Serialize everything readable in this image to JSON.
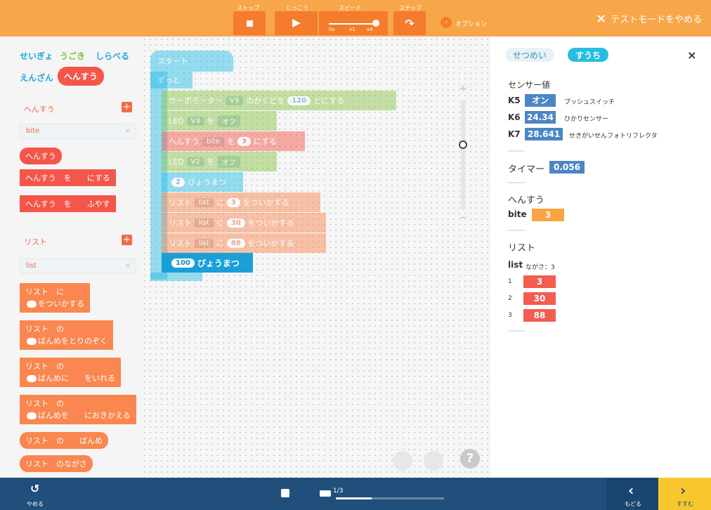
{
  "topbar": {
    "stop_caption": "ストップ",
    "run_caption": "じっこう",
    "speed_caption": "スピード",
    "step_caption": "ステップ",
    "speed_min": "0x",
    "speed_mid": "x1",
    "speed_max": "x4",
    "option_label": "オプション",
    "option_icon": "‹",
    "quit_label": "テストモードをやめる",
    "quit_icon": "×"
  },
  "palette": {
    "categories": [
      "せいぎょ",
      "うごき",
      "しらべる",
      "えんざん",
      "へんすう"
    ],
    "category_colors": [
      "#23a9dd",
      "#7cc142",
      "#23a9dd",
      "#23a9dd",
      "#f4564a"
    ],
    "var_section": "へんすう",
    "var_field": "bite",
    "var_blocks": [
      "へんすう",
      "へんすう　を　　にする",
      "へんすう　を　　ふやす"
    ],
    "list_section": "リスト",
    "list_field": "list",
    "list_blocks": [
      [
        "リスト　に",
        "をついかする"
      ],
      [
        "リスト　の",
        "ばんめをとりのぞく"
      ],
      [
        "リスト　の",
        "ばんめに　　をいれる"
      ],
      [
        "リスト　の",
        "ばんめを　　におきかえる"
      ],
      [
        "リスト　の　　ばんめ"
      ],
      [
        "リスト　のながさ"
      ]
    ],
    "field_clear_icon": "×",
    "plus_icon": "+"
  },
  "canvas": {
    "start": "スタート",
    "forever": "ずっと",
    "servo": [
      "サーボモーター",
      "V9",
      "のかくどを",
      "120",
      "どにする"
    ],
    "led1": [
      "LED",
      "V3",
      "を",
      "オフ"
    ],
    "setvar": [
      "へんすう",
      "bite",
      "を",
      "3",
      "にする"
    ],
    "led2": [
      "LED",
      "V2",
      "を",
      "オフ"
    ],
    "wait2": [
      "2",
      "びょうまつ"
    ],
    "list1": [
      "リスト",
      "list",
      "に",
      "3",
      "をついかする"
    ],
    "list2": [
      "リスト",
      "list",
      "に",
      "30",
      "をついかする"
    ],
    "list3": [
      "リスト",
      "list",
      "に",
      "88",
      "をついかする"
    ],
    "wait100": [
      "100",
      "びょうまつ"
    ],
    "zoom_in": "+",
    "zoom_out": "−",
    "help": "?"
  },
  "rpanel": {
    "tab_explain": "せつめい",
    "tab_values": "すうち",
    "close_icon": "×",
    "sensor_title": "センサー値",
    "sensors": [
      {
        "key": "K5",
        "value": "オン",
        "name": "プッシュスイッチ"
      },
      {
        "key": "K6",
        "value": "24.34",
        "name": "ひかりセンサー"
      },
      {
        "key": "K7",
        "value": "28.641",
        "name": "せきがいせんフォトリフレクタ"
      }
    ],
    "timer_label": "タイマー",
    "timer_value": "0.056",
    "var_title": "へんすう",
    "var_name": "bite",
    "var_value": "3",
    "list_title": "リスト",
    "list_name": "list",
    "list_len": "ながさ：3",
    "list_items": [
      {
        "i": "1",
        "v": "3"
      },
      {
        "i": "2",
        "v": "30"
      },
      {
        "i": "3",
        "v": "88"
      }
    ]
  },
  "bottombar": {
    "quit_label": "やめる",
    "page": "1/3",
    "progress": 0.33,
    "prev_label": "もどる",
    "next_label": "すすむ",
    "quit_icon": "↺",
    "prev_icon": "‹",
    "next_icon": "›"
  }
}
